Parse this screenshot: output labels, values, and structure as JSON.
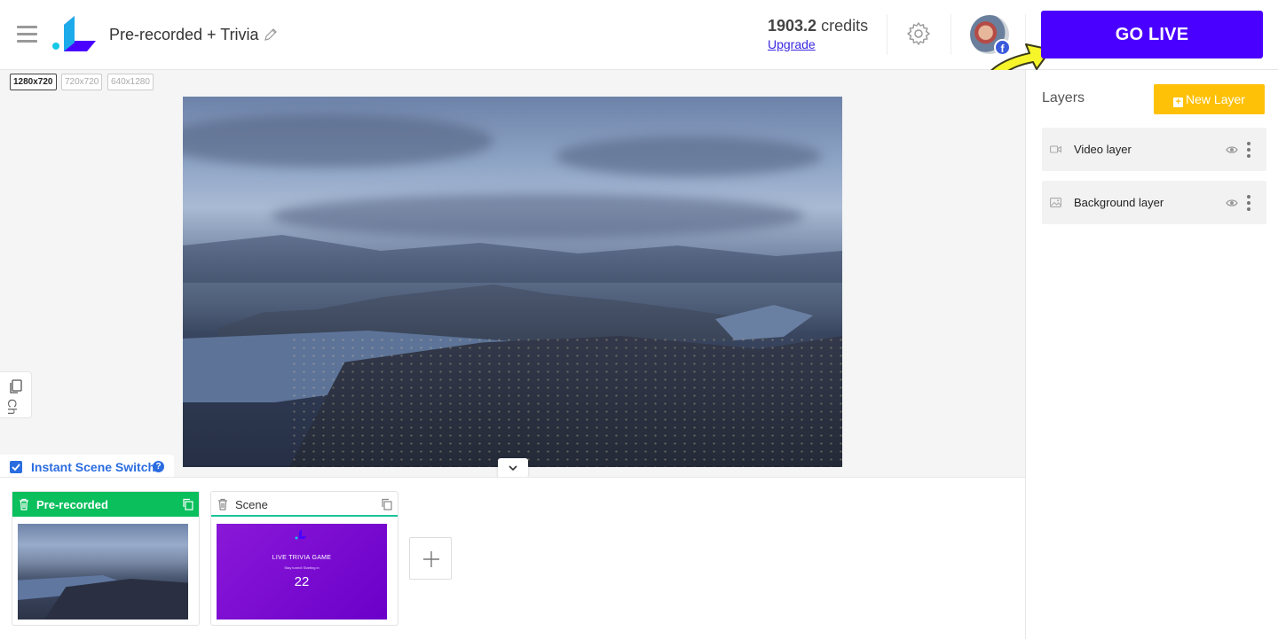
{
  "header": {
    "title": "Pre-recorded + Trivia",
    "credits_value": "1903.2",
    "credits_unit": "credits",
    "upgrade_label": "Upgrade",
    "go_live_label": "GO LIVE",
    "avatar_badge": "f"
  },
  "stage": {
    "resolutions": [
      {
        "label": "1280x720",
        "selected": true
      },
      {
        "label": "720x720",
        "selected": false
      },
      {
        "label": "640x1280",
        "selected": false
      }
    ],
    "side_tab_label": "Ch",
    "instant_scene_switch": {
      "label": "Instant Scene Switch",
      "checked": true,
      "help": "?"
    }
  },
  "scenes": [
    {
      "name": "Pre-recorded",
      "active": true,
      "thumbnail": "city-aerial"
    },
    {
      "name": "Scene",
      "active": false,
      "thumbnail": "trivia",
      "trivia": {
        "title": "LIVE TRIVIA GAME",
        "subtitle": "Stay tuned! Starting in",
        "countdown": "22"
      }
    }
  ],
  "layers_panel": {
    "title": "Layers",
    "new_layer_label": "New Layer",
    "layers": [
      {
        "name": "Video layer",
        "icon": "video-camera-icon"
      },
      {
        "name": "Background layer",
        "icon": "image-icon"
      }
    ]
  },
  "colors": {
    "go_live": "#4a00ff",
    "new_layer": "#ffc107",
    "active_scene": "#0bbf5d",
    "link": "#3a28e0",
    "instant_switch": "#2b6de0"
  }
}
